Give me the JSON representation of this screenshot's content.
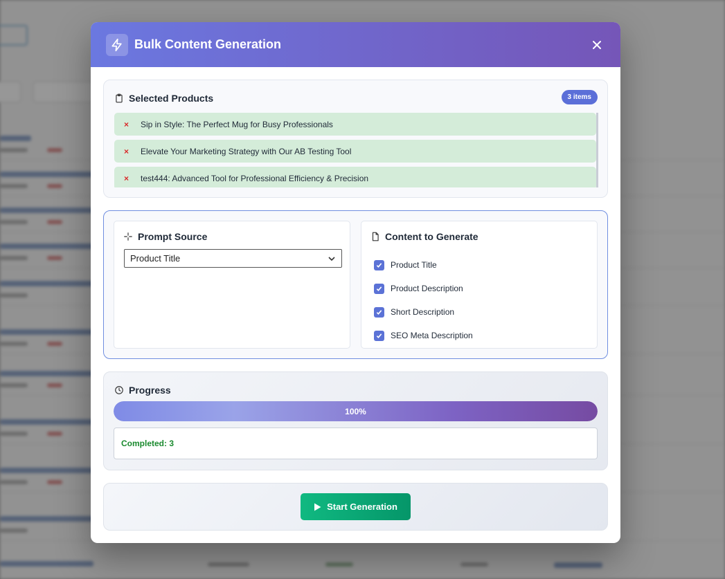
{
  "modal": {
    "title": "Bulk Content Generation",
    "close_label": "×"
  },
  "selected_products": {
    "heading": "Selected Products",
    "count_badge": "3 items",
    "items": [
      {
        "remove": "×",
        "name": "Sip in Style: The Perfect Mug for Busy Professionals"
      },
      {
        "remove": "×",
        "name": "Elevate Your Marketing Strategy with Our AB Testing Tool"
      },
      {
        "remove": "×",
        "name": "test444: Advanced Tool for Professional Efficiency & Precision"
      }
    ]
  },
  "prompt_source": {
    "heading": "Prompt Source",
    "selected": "Product Title"
  },
  "content_to_generate": {
    "heading": "Content to Generate",
    "options": [
      {
        "label": "Product Title",
        "checked": true
      },
      {
        "label": "Product Description",
        "checked": true
      },
      {
        "label": "Short Description",
        "checked": true
      },
      {
        "label": "SEO Meta Description",
        "checked": true
      }
    ]
  },
  "progress": {
    "heading": "Progress",
    "percent_label": "100%",
    "percent_value": 100,
    "status_text": "Completed: 3"
  },
  "actions": {
    "start_label": "Start Generation"
  },
  "colors": {
    "header_start": "#6b78e0",
    "header_end": "#7556b8",
    "accent": "#5b72d6",
    "success": "#10b981",
    "product_bg": "#d4ecd9",
    "remove": "#d92b2b"
  },
  "icons": {
    "header": "lightning-icon",
    "close": "close-icon",
    "products": "clipboard-icon",
    "prompt": "sparkle-icon",
    "content": "document-icon",
    "progress": "clock-icon",
    "start": "play-icon"
  }
}
